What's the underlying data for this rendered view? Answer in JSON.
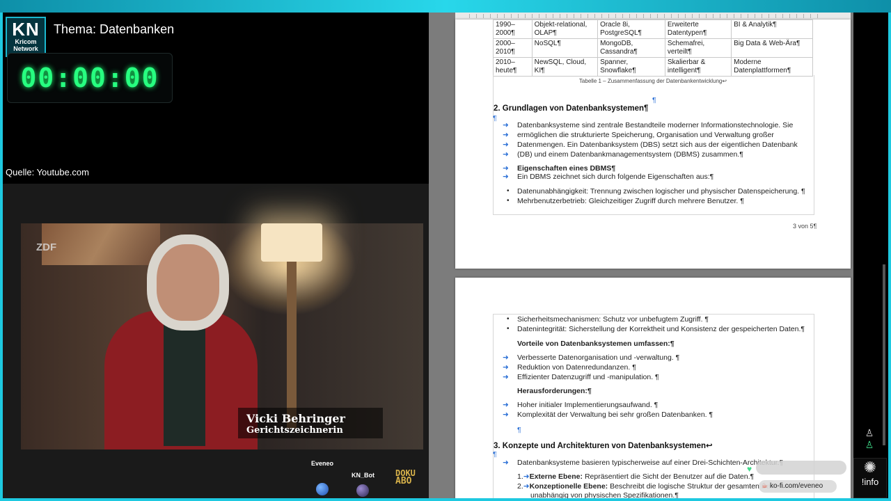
{
  "overlay": {
    "logo_main": "KN",
    "logo_line1": "Kricom",
    "logo_line2": "Network",
    "topic": "Thema: Datenbanken",
    "timer": "00:00:00",
    "source": "Quelle: Youtube.com"
  },
  "video": {
    "channel_logo": "ZDF",
    "person_name": "Vicki Behringer",
    "person_role": "Gerichtszeichnerin",
    "chat_user1": "Eveneo",
    "chat_user2": "KN_Bot",
    "badge_line1": "DOKU",
    "badge_line2": "ABO"
  },
  "document": {
    "table": [
      [
        "1990–2000¶",
        "Objekt-relational, OLAP¶",
        "Oracle 8i, PostgreSQL¶",
        "Erweiterte Datentypen¶",
        "BI & Analytik¶"
      ],
      [
        "2000–2010¶",
        "NoSQL¶",
        "MongoDB, Cassandra¶",
        "Schemafrei, verteilt¶",
        "Big Data & Web-Ära¶"
      ],
      [
        "2010–heute¶",
        "NewSQL, Cloud, KI¶",
        "Spanner, Snowflake¶",
        "Skalierbar & intelligent¶",
        "Moderne Datenplattformen¶"
      ]
    ],
    "caption": "Tabelle 1 – Zusammenfassung der Datenbankentwicklung↩",
    "section2_title": "2. Grundlagen von Datenbanksystemen¶",
    "s2_lines": [
      "Datenbanksysteme sind zentrale Bestandteile moderner Informationstechnologie. Sie",
      "ermöglichen die strukturierte Speicherung, Organisation und Verwaltung großer",
      "Datenmengen. Ein Datenbanksystem (DBS) setzt sich aus der eigentlichen Datenbank",
      "(DB) und einem Datenbankmanagementsystem (DBMS) zusammen.¶"
    ],
    "dbms_heading": "Eigenschaften eines DBMS¶",
    "dbms_intro": "Ein DBMS zeichnet sich durch folgende Eigenschaften aus:¶",
    "bullets_p1": [
      "Datenunabhängigkeit: Trennung zwischen logischer und physischer Datenspeicherung. ¶",
      "Mehrbenutzerbetrieb: Gleichzeitiger Zugriff durch mehrere Benutzer. ¶"
    ],
    "page_number": "3 von 5¶",
    "bullets_p2": [
      "Sicherheitsmechanismen: Schutz vor unbefugtem Zugriff. ¶",
      "Datenintegrität: Sicherstellung der Korrektheit und Konsistenz der gespeicherten Daten.¶"
    ],
    "vorteile_heading": "Vorteile von Datenbanksystemen umfassen:¶",
    "vorteile": [
      "Verbesserte Datenorganisation und -verwaltung. ¶",
      "Reduktion von Datenredundanzen. ¶",
      "Effizienter Datenzugriff und -manipulation. ¶"
    ],
    "heraus_heading": "Herausforderungen:¶",
    "heraus": [
      "Hoher initialer Implementierungsaufwand. ¶",
      "Komplexität der Verwaltung bei sehr großen Datenbanken. ¶"
    ],
    "section3_title": "3. Konzepte und Architekturen von Datenbanksystemen↩",
    "s3_intro": "Datenbanksysteme basieren typischerweise auf einer Drei-Schichten-Architektur.¶",
    "s3_item1_label": "Externe Ebene:",
    "s3_item1_text": " Repräsentiert die Sicht der Benutzer auf die Daten.¶",
    "s3_item2_label": "Konzeptionelle Ebene:",
    "s3_item2_text": " Beschreibt die logische Struktur der gesamten Datenbank",
    "s3_item2_cont": "unabhängig von physischen Spezifikationen.¶"
  },
  "widgets": {
    "ko_text": "ko-fi.com/eveneo",
    "info_label": "!info"
  },
  "colors": {
    "frame": "#1ec9e0",
    "timer": "#27ff80",
    "pilcrow": "#2a6fd6"
  }
}
